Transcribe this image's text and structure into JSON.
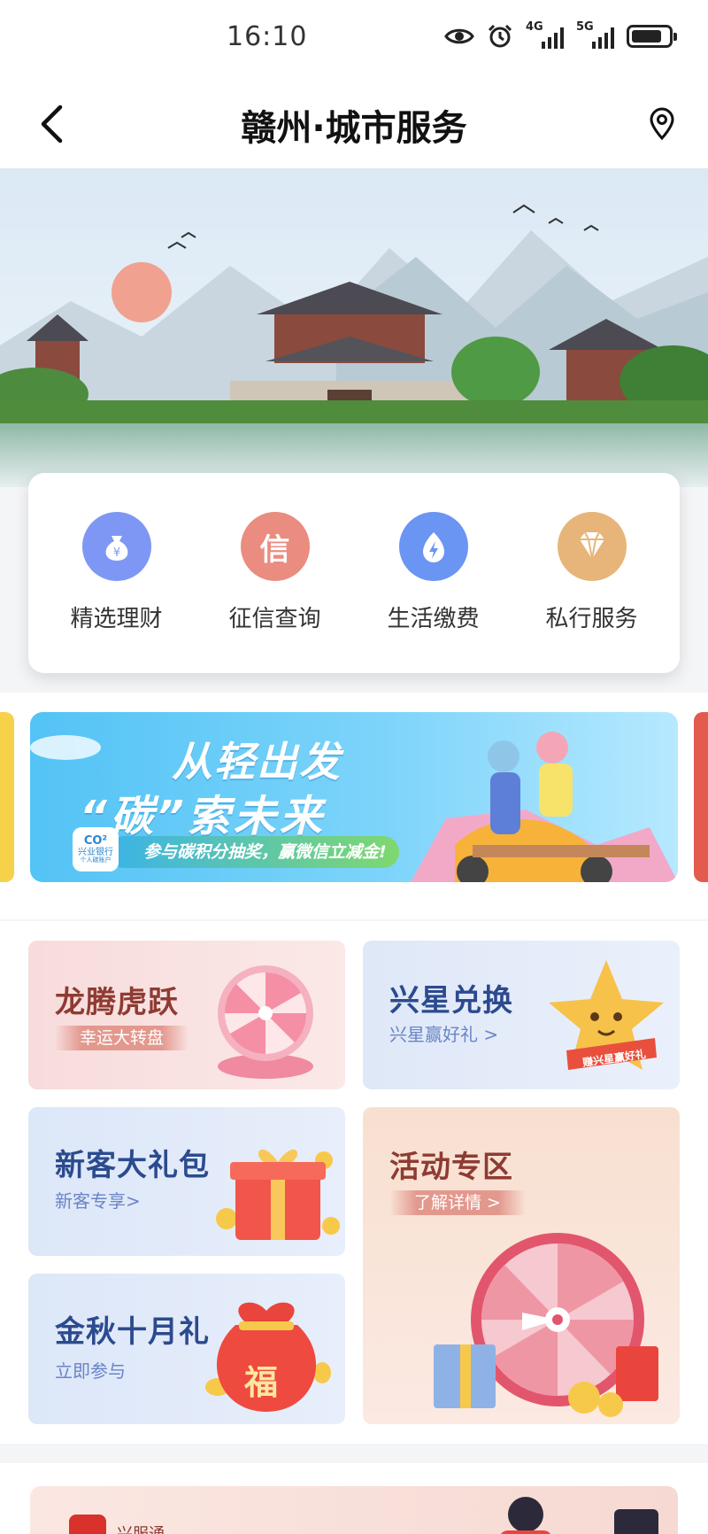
{
  "status_bar": {
    "time": "16:10",
    "net1": "4G",
    "net2": "5G"
  },
  "header": {
    "title": "赣州·城市服务"
  },
  "services": [
    {
      "label": "精选理财",
      "icon": "money-bag-icon",
      "color": "#6f8cf0"
    },
    {
      "label": "征信查询",
      "icon": "credit-icon",
      "glyph": "信",
      "color": "#e8857a"
    },
    {
      "label": "生活缴费",
      "icon": "lightning-icon",
      "color": "#5b8df2"
    },
    {
      "label": "私行服务",
      "icon": "diamond-icon",
      "color": "#e0ad6c"
    }
  ],
  "promo": {
    "line1": "从轻出发",
    "line2": "“碳”索未来",
    "sub": "参与碳积分抽奖，赢微信立减金!",
    "logo_line1": "CO²",
    "logo_line2": "兴业银行",
    "logo_line3": "个人碳账户"
  },
  "activities": {
    "dragon": {
      "title": "龙腾虎跃",
      "sub": "幸运大转盘"
    },
    "star": {
      "title": "兴星兑换",
      "sub": "兴星赢好礼 >",
      "badge": "赚兴星赢好礼"
    },
    "newcomer": {
      "title": "新客大礼包",
      "sub": "新客专享>"
    },
    "zone": {
      "title": "活动专区",
      "sub": "了解详情 >"
    },
    "autumn": {
      "title": "金秋十月礼",
      "sub": "立即参与",
      "bag_glyph": "福"
    }
  },
  "footer_card": {
    "brand": "兴服通"
  }
}
